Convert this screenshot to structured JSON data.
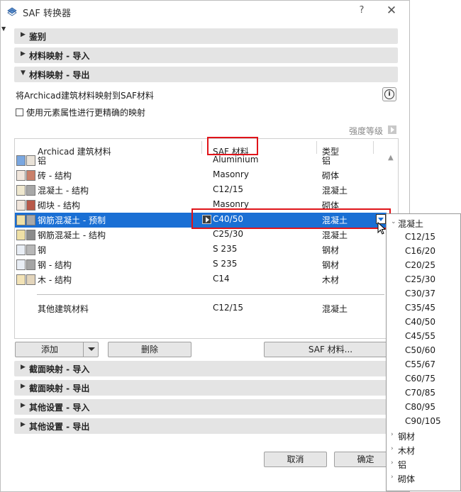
{
  "window": {
    "title": "SAF 转换器",
    "help": "?",
    "close": "✕"
  },
  "sections_top": [
    {
      "label": "鉴别",
      "expanded": false
    },
    {
      "label": "材料映射 - 导入",
      "expanded": false
    },
    {
      "label": "材料映射 - 导出",
      "expanded": true
    }
  ],
  "export": {
    "description": "将Archicad建筑材料映射到SAF材料",
    "checkbox_label": "使用元素属性进行更精确的映射",
    "checkbox_checked": false,
    "strength_label": "强度等级"
  },
  "table": {
    "headers": {
      "material": "Archicad 建筑材料",
      "saf": "SAF 材料",
      "type": "类型"
    },
    "rows": [
      {
        "name": "铝",
        "saf": "Aluminium",
        "type": "铝",
        "c1": "#7aa7e0",
        "c2": "#e9e2d8"
      },
      {
        "name": "砖 - 结构",
        "saf": "Masonry",
        "type": "砌体",
        "c1": "#f1e6dc",
        "c2": "#c9806a"
      },
      {
        "name": "混凝土 - 结构",
        "saf": "C12/15",
        "type": "混凝土",
        "c1": "#efe8cf",
        "c2": "#a8a8a8"
      },
      {
        "name": "砌块 - 结构",
        "saf": "Masonry",
        "type": "砌体",
        "c1": "#f1e6dc",
        "c2": "#b85a4a"
      },
      {
        "name": "钢筋混凝土 - 预制",
        "saf": "C40/50",
        "type": "混凝土",
        "c1": "#efe0a6",
        "c2": "#a8a8a8"
      },
      {
        "name": "钢筋混凝土 - 结构",
        "saf": "C25/30",
        "type": "混凝土",
        "c1": "#efe0a6",
        "c2": "#8c8c8c"
      },
      {
        "name": "钢",
        "saf": "S 235",
        "type": "钢材",
        "c1": "#e9eef5",
        "c2": "#b8b8b8"
      },
      {
        "name": "钢 - 结构",
        "saf": "S 235",
        "type": "钢材",
        "c1": "#e9eef5",
        "c2": "#a5a5a5"
      },
      {
        "name": "木 - 结构",
        "saf": "C14",
        "type": "木材",
        "c1": "#f3e3b6",
        "c2": "#e3d5bc"
      }
    ],
    "other": {
      "name": "其他建筑材料",
      "saf": "C12/15",
      "type": "混凝土"
    }
  },
  "buttons": {
    "add": "添加",
    "delete": "删除",
    "saf_material": "SAF 材料...",
    "cancel": "取消",
    "ok": "确定"
  },
  "sections_bottom": [
    {
      "label": "截面映射 - 导入"
    },
    {
      "label": "截面映射 - 导出"
    },
    {
      "label": "其他设置 - 导入"
    },
    {
      "label": "其他设置 - 导出"
    }
  ],
  "popup": {
    "group_open": "混凝土",
    "concrete_items": [
      "C12/15",
      "C16/20",
      "C20/25",
      "C25/30",
      "C30/37",
      "C35/45",
      "C40/50",
      "C45/55",
      "C50/60",
      "C55/67",
      "C60/75",
      "C70/85",
      "C80/95",
      "C90/105"
    ],
    "other_groups": [
      "钢材",
      "木材",
      "铝",
      "砌体"
    ]
  },
  "colors": {
    "selection": "#1a6fd4",
    "highlight": "#e0141a",
    "section_bg": "#e4e4e4"
  }
}
